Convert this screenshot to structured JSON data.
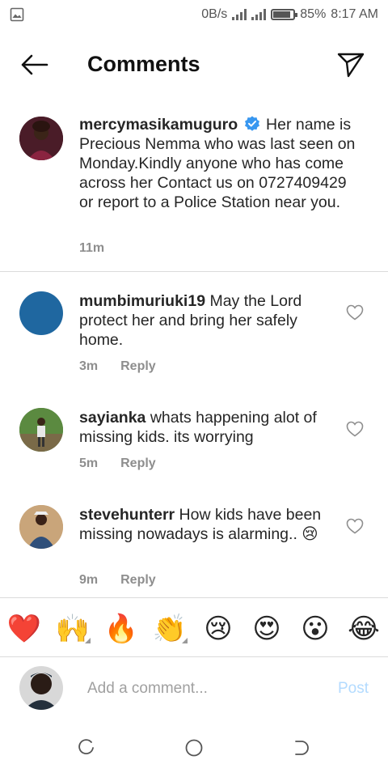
{
  "status_bar": {
    "speed": "0B/s",
    "battery": "85%",
    "battery_level": 0.85,
    "time": "8:17 AM"
  },
  "header": {
    "title": "Comments"
  },
  "caption": {
    "username": "mercymasikamuguro",
    "text": "Her name is Precious Nemma who was last seen on Monday.Kindly anyone who has come across her Contact us on 0727409429 or report to a Police Station near you.",
    "time": "11m",
    "verified": true
  },
  "comments": [
    {
      "username": "mumbimuriuki19",
      "text": "May the Lord protect her and bring her safely home.",
      "time": "3m",
      "reply_label": "Reply"
    },
    {
      "username": "sayianka",
      "text": "whats happening alot of missing kids.  its worrying",
      "time": "5m",
      "reply_label": "Reply"
    },
    {
      "username": "stevehunterr",
      "text": "How kids have been missing nowadays is alarming..",
      "emoji": "😢",
      "time": "9m",
      "reply_label": "Reply"
    }
  ],
  "emoji_bar": [
    "❤️",
    "🙌",
    "🔥",
    "👏",
    "😢",
    "😍",
    "😮",
    "😂"
  ],
  "composer": {
    "placeholder": "Add a comment...",
    "post_label": "Post"
  },
  "colors": {
    "accent": "#3897f0",
    "post_disabled": "#b3dbff",
    "verified": "#3897f0",
    "muted": "#8e8e8e"
  }
}
